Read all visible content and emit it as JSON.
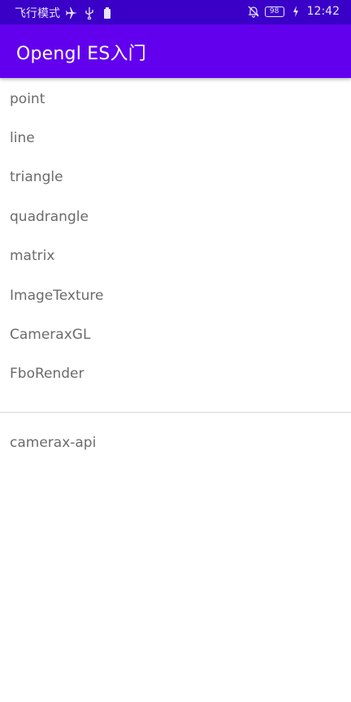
{
  "status_bar": {
    "carrier": "飞行模式",
    "battery": "98",
    "time": "12:42",
    "icons": [
      "airplane-icon",
      "usb-icon",
      "battery-saver-icon",
      "mute-icon",
      "charging-icon"
    ]
  },
  "app_bar": {
    "title": "Opengl ES入门",
    "color": "#6200ee"
  },
  "list": {
    "items": [
      "point",
      "line",
      "triangle",
      "quadrangle",
      "matrix",
      "ImageTexture",
      "CameraxGL",
      "FboRender"
    ],
    "secondary_items": [
      "camerax-api"
    ]
  }
}
